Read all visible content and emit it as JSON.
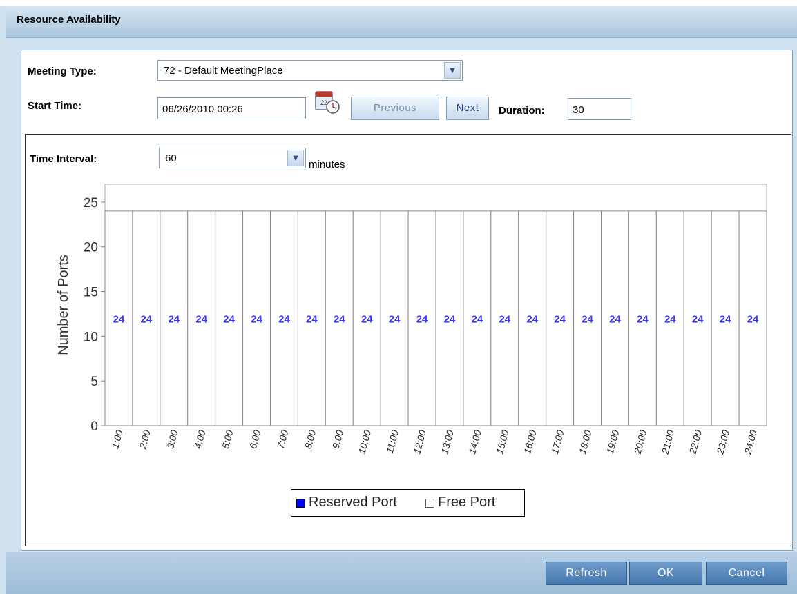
{
  "window": {
    "title": "Resource Availability"
  },
  "form": {
    "meeting_type_label": "Meeting Type:",
    "meeting_type_value": "72 - Default MeetingPlace",
    "start_time_label": "Start Time:",
    "start_time_value": "06/26/2010 00:26",
    "previous_label": "Previous",
    "next_label": "Next",
    "duration_label": "Duration:",
    "duration_value": "30",
    "interval_label": "Time Interval:",
    "interval_value": "60",
    "interval_unit": "minutes"
  },
  "icons": {
    "calendar": "calendar-clock-icon",
    "dropdown": "chevron-down-icon"
  },
  "colors": {
    "reserved": "#0000ff",
    "free": "#ffffff",
    "value_label": "#3333ff"
  },
  "chart_data": {
    "type": "bar",
    "categories": [
      "1:00",
      "2:00",
      "3:00",
      "4:00",
      "5:00",
      "6:00",
      "7:00",
      "8:00",
      "9:00",
      "10:00",
      "11:00",
      "12:00",
      "13:00",
      "14:00",
      "15:00",
      "16:00",
      "17:00",
      "18:00",
      "19:00",
      "20:00",
      "21:00",
      "22:00",
      "23:00",
      "24:00"
    ],
    "series": [
      {
        "name": "Reserved Port",
        "values": [
          0,
          0,
          0,
          0,
          0,
          0,
          0,
          0,
          0,
          0,
          0,
          0,
          0,
          0,
          0,
          0,
          0,
          0,
          0,
          0,
          0,
          0,
          0,
          0
        ]
      },
      {
        "name": "Free Port",
        "values": [
          24,
          24,
          24,
          24,
          24,
          24,
          24,
          24,
          24,
          24,
          24,
          24,
          24,
          24,
          24,
          24,
          24,
          24,
          24,
          24,
          24,
          24,
          24,
          24
        ]
      }
    ],
    "data_labels": [
      "24",
      "24",
      "24",
      "24",
      "24",
      "24",
      "24",
      "24",
      "24",
      "24",
      "24",
      "24",
      "24",
      "24",
      "24",
      "24",
      "24",
      "24",
      "24",
      "24",
      "24",
      "24",
      "24",
      "24"
    ],
    "ylabel": "Number of Ports",
    "ylim": [
      0,
      27
    ],
    "yticks": [
      "0",
      "5",
      "10",
      "15",
      "20",
      "25"
    ],
    "stacked": true,
    "legend_position": "bottom-center"
  },
  "footer": {
    "refresh_label": "Refresh",
    "ok_label": "OK",
    "cancel_label": "Cancel"
  }
}
